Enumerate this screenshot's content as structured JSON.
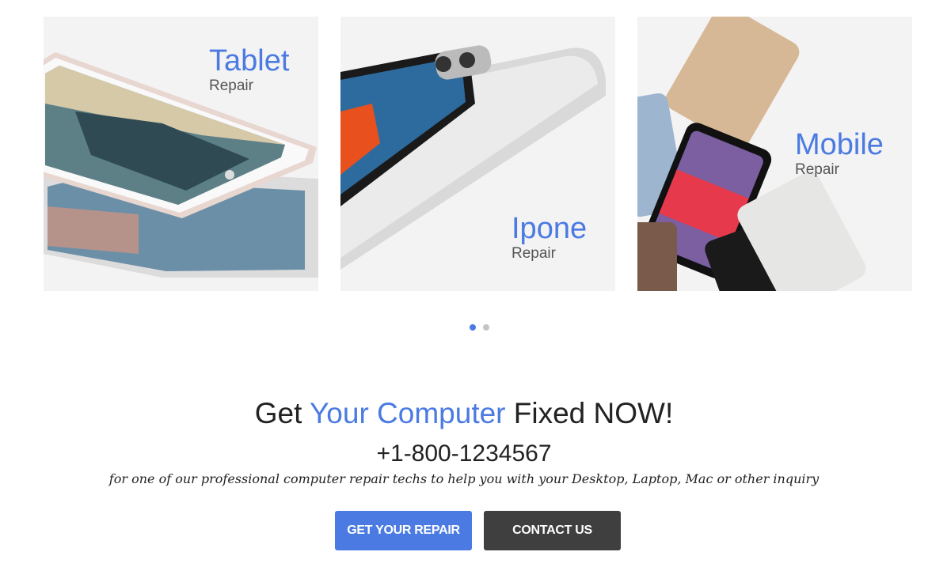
{
  "cards": [
    {
      "title": "Tablet",
      "subtitle": "Repair"
    },
    {
      "title": "Ipone",
      "subtitle": "Repair"
    },
    {
      "title": "Mobile",
      "subtitle": "Repair"
    }
  ],
  "carousel": {
    "pages": 2,
    "active": 1
  },
  "cta": {
    "heading_pre": "Get ",
    "heading_accent": "Your Computer",
    "heading_post": " Fixed NOW!",
    "phone": "+1-800-1234567",
    "note": "for one of our professional computer repair techs to help you with your Desktop, Laptop, Mac or other inquiry"
  },
  "buttons": {
    "repair": "GET YOUR REPAIR",
    "contact": "CONTACT US"
  },
  "colors": {
    "accent": "#4a7ae2",
    "dark_button": "#3f3f3f",
    "card_bg": "#f3f3f3"
  }
}
